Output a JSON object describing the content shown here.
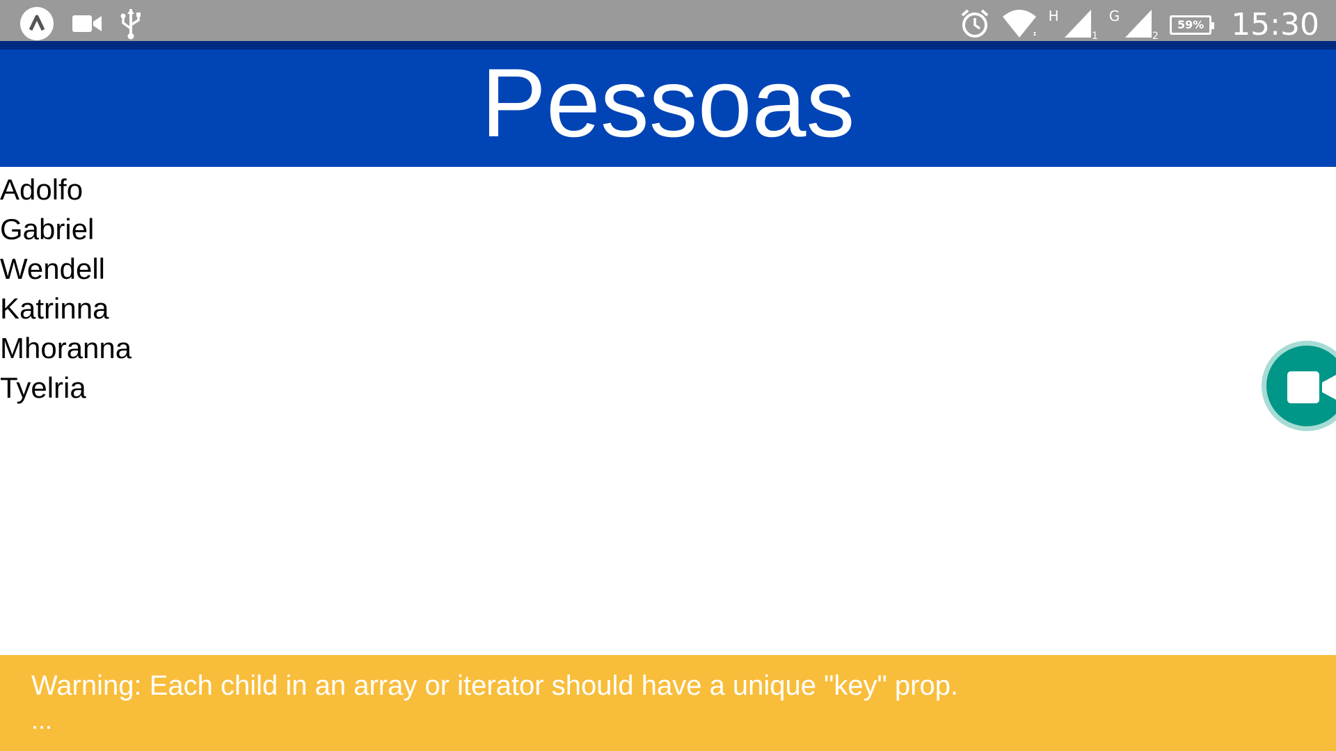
{
  "status_bar": {
    "left_icons": [
      "app-notification-icon",
      "video-camera-icon",
      "usb-icon"
    ],
    "right_icons": [
      "alarm-icon",
      "wifi-icon",
      "signal-sim1-icon",
      "signal-sim2-icon",
      "battery-icon"
    ],
    "network_sim1": "H",
    "network_sim2": "G",
    "sim1_index": "1",
    "sim2_index": "2",
    "battery_level": "59%",
    "time": "15:30"
  },
  "appbar": {
    "title": "Pessoas"
  },
  "people": [
    "Adolfo",
    "Gabriel",
    "Wendell",
    "Katrinna",
    "Mhoranna",
    "Tyelria"
  ],
  "fab": {
    "icon": "video-camera-icon"
  },
  "warning": {
    "message": "Warning: Each child in an array or iterator should have a unique \"key\" prop.",
    "more": "..."
  },
  "colors": {
    "status_bar": "#9a9a9a",
    "appbar": "#0044b5",
    "fab": "#009688",
    "warning": "#f8bd3b"
  }
}
